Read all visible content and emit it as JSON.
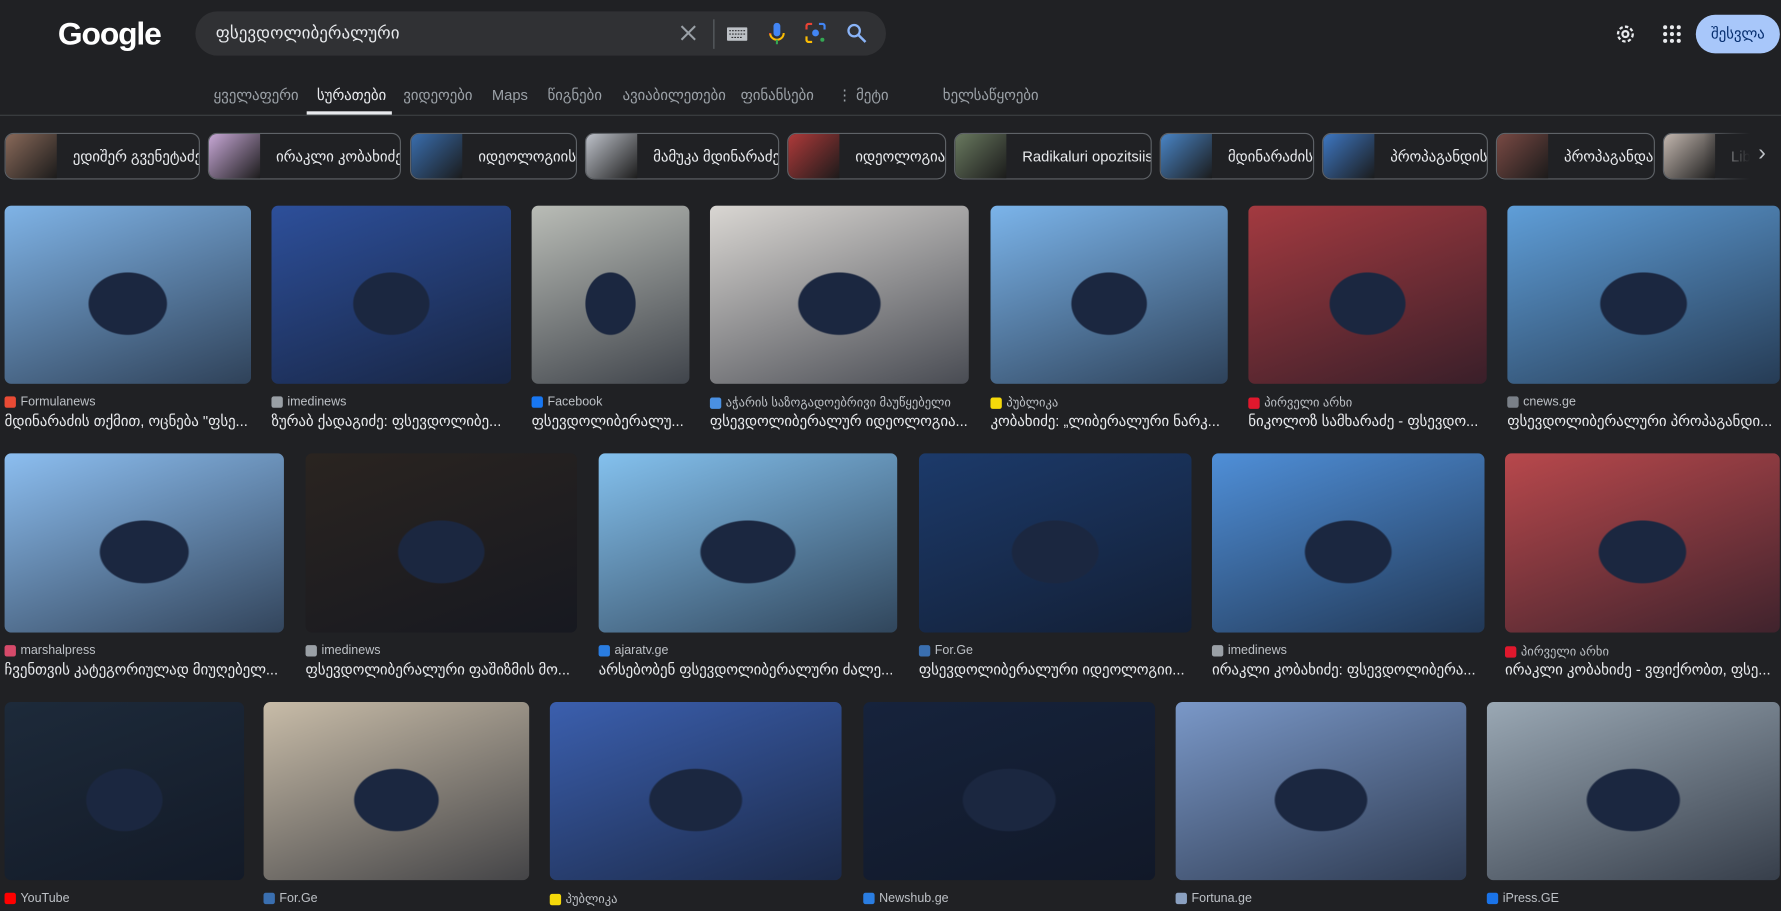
{
  "header": {
    "logo": "Google",
    "query": "ფსევდოლიბერალური",
    "signin_label": "შესვლა"
  },
  "tabs": [
    {
      "label": "ყველაფერი",
      "active": false
    },
    {
      "label": "სურათები",
      "active": true
    },
    {
      "label": "ვიდეოები",
      "active": false
    },
    {
      "label": "Maps",
      "active": false
    },
    {
      "label": "წიგნები",
      "active": false
    },
    {
      "label": "ავიაბილეთები",
      "active": false
    },
    {
      "label": "ფინანსები",
      "active": false
    },
    {
      "label": "⋮ მეტი",
      "active": false
    },
    {
      "label": "ხელსაწყოები",
      "active": false
    }
  ],
  "chips": [
    {
      "label": "ედიშერ გვენეტაძე",
      "color": "#8a6a5a"
    },
    {
      "label": "ირაკლი კობახიძე",
      "color": "#c9a9d8"
    },
    {
      "label": "იდეოლოგიის",
      "color": "#3a6fb0"
    },
    {
      "label": "მამუკა მდინარაძე",
      "color": "#c0c4cc"
    },
    {
      "label": "იდეოლოგია",
      "color": "#b03a3a"
    },
    {
      "label": "Radikaluri opozitsiis",
      "color": "#6a7a60"
    },
    {
      "label": "მდინარაძის",
      "color": "#4a86c8"
    },
    {
      "label": "პროპაგანდის",
      "color": "#3e78c4"
    },
    {
      "label": "პროპაგანდა",
      "color": "#7a4a44"
    },
    {
      "label": "Liberal",
      "color": "#c4b8b0"
    }
  ],
  "results": [
    {
      "source": "Formulanews",
      "title": "მდინარაძის თქმით, ოცნება \"ფსე...",
      "color": "#7fb3e6",
      "icon": "#e94b35"
    },
    {
      "source": "imedinews",
      "title": "ზურაბ ქადაგიძე: ფსევდოლიბე...",
      "color": "#2d4f9a",
      "icon": "#9aa0a6"
    },
    {
      "source": "Facebook",
      "title": "ფსევდოლიბერალუ...",
      "color": "#b9bcb6",
      "icon": "#1877f2"
    },
    {
      "source": "აჭარის საზოგადოებრივი მაუწყებელი",
      "title": "ფსევდოლიბერალურ იდეოლოგია...",
      "color": "#d9d6d2",
      "icon": "#4a90e2"
    },
    {
      "source": "პუბლიკა",
      "title": "კობახიძე: „ლიბერალური ნარკ...",
      "color": "#7bb4ea",
      "icon": "#f5d90a"
    },
    {
      "source": "პირველი არხი",
      "title": "ნიკოლოზ სამხარაძე - ფსევდო...",
      "color": "#a33a40",
      "icon": "#e0182d"
    },
    {
      "source": "cnews.ge",
      "title": "ფსევდოლიბერალური პროპაგანდი...",
      "color": "#5f9ed8",
      "icon": "#7a8088"
    },
    {
      "source": "marshalpress",
      "title": "ჩვენთვის კატეგორიულად მიუღებელ...",
      "color": "#8cbef0",
      "icon": "#d64a6a"
    },
    {
      "source": "imedinews",
      "title": "ფსევდოლიბერალური ფაშიზმის მო...",
      "color": "#2a2420",
      "icon": "#9aa0a6"
    },
    {
      "source": "ajaratv.ge",
      "title": "არსებობენ ფსევდოლიბერალური ძალე...",
      "color": "#84c1ee",
      "icon": "#2a7de1"
    },
    {
      "source": "For.Ge",
      "title": "ფსევდოლიბერალური იდეოლოგიი...",
      "color": "#1c3a6a",
      "icon": "#3a6fb0"
    },
    {
      "source": "imedinews",
      "title": "ირაკლი კობახიძე: ფსევდოლიბერა...",
      "color": "#4f8fd8",
      "icon": "#9aa0a6"
    },
    {
      "source": "პირველი არხი",
      "title": "ირაკლი კობახიძე - ვფიქრობთ, ფსე...",
      "color": "#b8484c",
      "icon": "#e0182d"
    },
    {
      "source": "YouTube",
      "title": "",
      "color": "#1d2a3a",
      "icon": "#ff0000"
    },
    {
      "source": "For.Ge",
      "title": "",
      "color": "#c8bca8",
      "icon": "#3a6fb0"
    },
    {
      "source": "პუბლიკა",
      "title": "",
      "color": "#3b5fae",
      "icon": "#f5d90a"
    },
    {
      "source": "Newshub.ge",
      "title": "",
      "color": "#16233c",
      "icon": "#2a7de1"
    },
    {
      "source": "Fortuna.ge",
      "title": "",
      "color": "#7a98c8",
      "icon": "#8aa0c0"
    },
    {
      "source": "iPress.GE",
      "title": "",
      "color": "#9aa8b4",
      "icon": "#1a73e8"
    }
  ]
}
